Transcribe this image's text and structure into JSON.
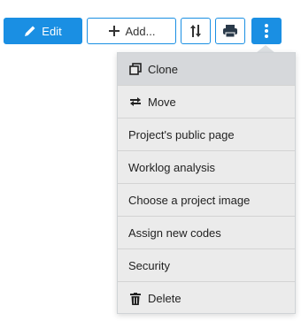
{
  "toolbar": {
    "edit_label": "Edit",
    "add_label": "Add...",
    "sort_icon": "sort-arrows-icon",
    "print_icon": "printer-icon",
    "more_icon": "vertical-ellipsis-icon"
  },
  "menu": {
    "items": [
      {
        "label": "Clone",
        "icon": "clone-icon"
      },
      {
        "label": "Move",
        "icon": "move-arrows-icon"
      },
      {
        "label": "Project's public page"
      },
      {
        "label": "Worklog analysis"
      },
      {
        "label": "Choose a project image"
      },
      {
        "label": "Assign new codes"
      },
      {
        "label": "Security"
      },
      {
        "label": "Delete",
        "icon": "trash-icon"
      }
    ]
  },
  "colors": {
    "primary": "#1a8fe3",
    "menu_bg": "#ebebeb",
    "menu_hover": "#d6d8db"
  }
}
